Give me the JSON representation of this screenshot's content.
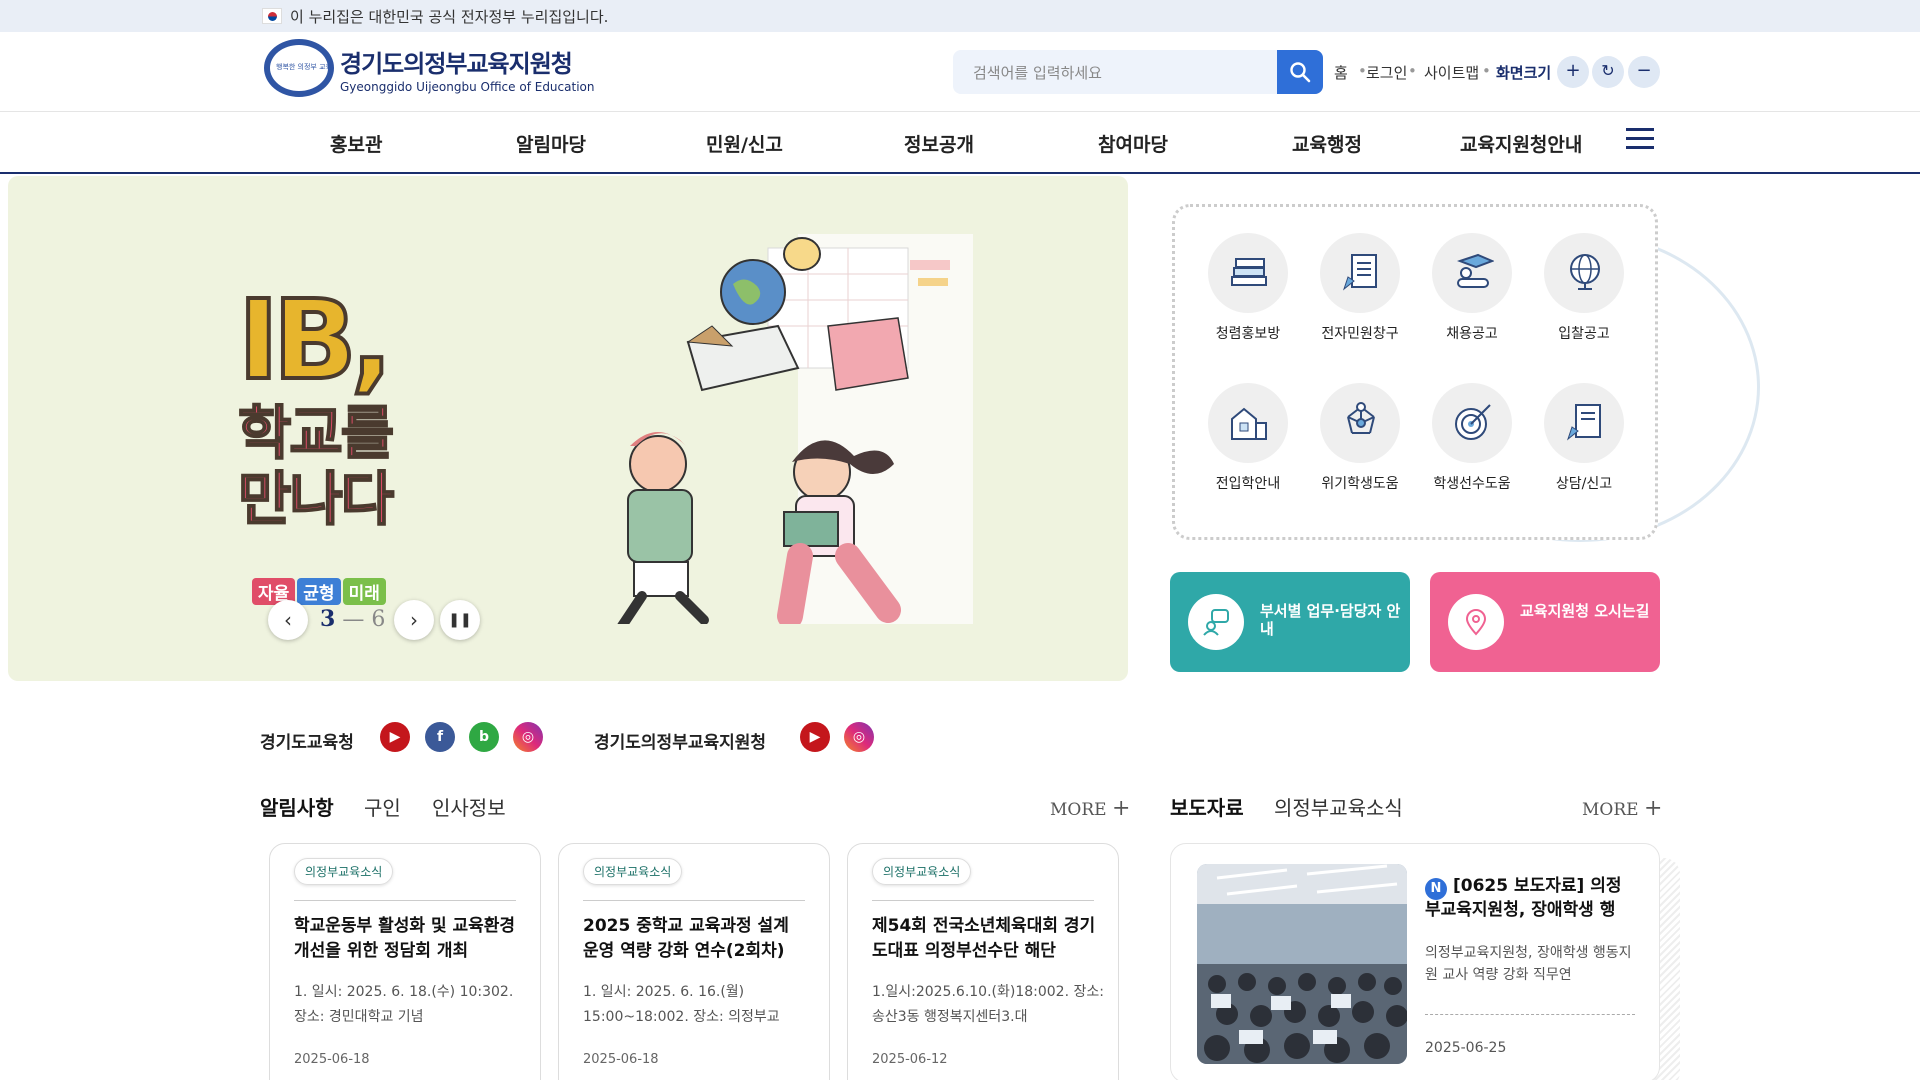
{
  "gov_banner": {
    "text": "이 누리집은 대한민국 공식 전자정부 누리집입니다."
  },
  "header": {
    "logo_title": "경기도의정부교육지원청",
    "logo_subtitle": "Gyeonggido Uijeongbu Office of Education",
    "logo_ring_text": "행복한 의정부 교육",
    "search_placeholder": "검색어를 입력하세요",
    "util_links": [
      "홈",
      "로그인",
      "사이트맵"
    ],
    "font_size_label": "화면크기",
    "zoom_in": "+",
    "zoom_reset": "↻",
    "zoom_out": "−"
  },
  "gnb": {
    "items": [
      "홍보관",
      "알림마당",
      "민원/신고",
      "정보공개",
      "참여마당",
      "교육행정",
      "교육지원청안내"
    ]
  },
  "visual": {
    "headline_1": "IB,",
    "headline_2": "학교를",
    "headline_3": "만나다",
    "tags": [
      "자율",
      "균형",
      "미래"
    ],
    "pager_current": "3",
    "pager_sep": "—",
    "pager_total": "6"
  },
  "quick_menu": {
    "items": [
      {
        "label": "청렴홍보방",
        "icon": "books-icon"
      },
      {
        "label": "전자민원창구",
        "icon": "document-pencil-icon"
      },
      {
        "label": "채용공고",
        "icon": "graduate-icon"
      },
      {
        "label": "입찰공고",
        "icon": "globe-icon"
      },
      {
        "label": "전입학안내",
        "icon": "school-building-icon"
      },
      {
        "label": "위기학생도움",
        "icon": "network-icon"
      },
      {
        "label": "학생선수도움",
        "icon": "target-icon"
      },
      {
        "label": "상담/신고",
        "icon": "report-icon"
      }
    ]
  },
  "promo_buttons": {
    "dept": "부서별 업무·담당자 안내",
    "map": "교육지원청 오시는길"
  },
  "sns": {
    "group1_label": "경기도교육청",
    "group2_label": "경기도의정부교육지원청"
  },
  "notices": {
    "tabs": [
      "알림사항",
      "구인",
      "인사정보"
    ],
    "more": "MORE",
    "cards": [
      {
        "badge": "의정부교육소식",
        "title": "학교운동부 활성화 및 교육환경 개선을 위한 정담회 개최",
        "body": "1. 일시: 2025. 6. 18.(수) 10:302. 장소: 경민대학교 기념",
        "date": "2025-06-18"
      },
      {
        "badge": "의정부교육소식",
        "title": "2025 중학교 교육과정 설계 운영 역량 강화 연수(2회차)",
        "body": "1. 일시: 2025. 6. 16.(월) 15:00~18:002. 장소: 의정부교",
        "date": "2025-06-18"
      },
      {
        "badge": "의정부교육소식",
        "title": "제54회 전국소년체육대회 경기도대표 의정부선수단 해단",
        "body": "1.일시:2025.6.10.(화)18:002. 장소:송산3동 행정복지센터3.대",
        "date": "2025-06-12"
      }
    ]
  },
  "press": {
    "tabs": [
      "보도자료",
      "의정부교육소식"
    ],
    "more": "MORE",
    "new_badge": "N",
    "title": "[0625 보도자료] 의정부교육지원청, 장애학생 행",
    "body": "의정부교육지원청, 장애학생 행동지원 교사 역량 강화 직무연",
    "date": "2025-06-25"
  }
}
